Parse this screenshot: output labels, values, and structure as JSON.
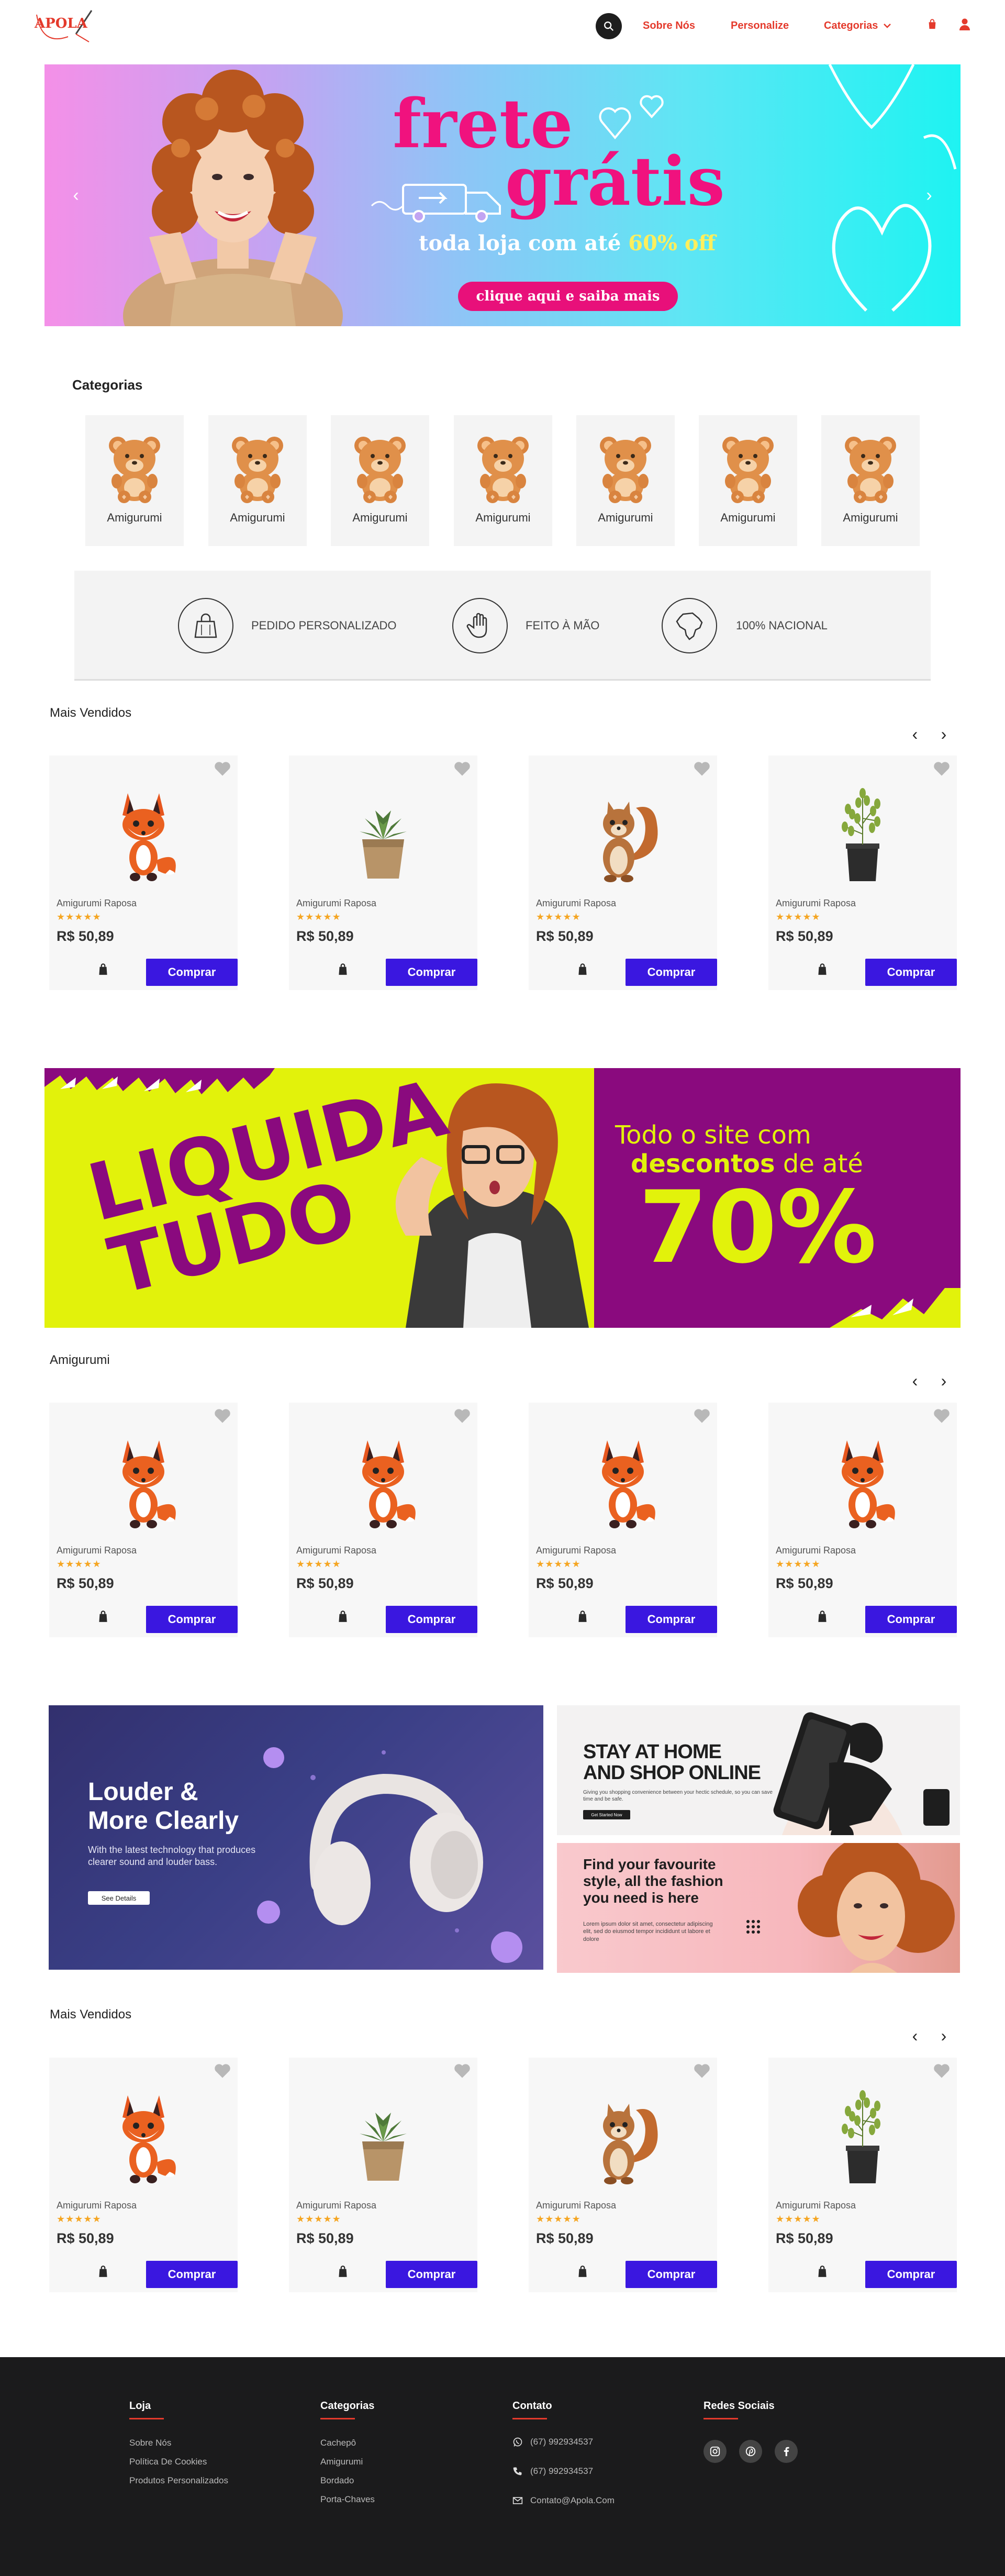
{
  "header": {
    "logo_text": "APOLA",
    "nav": {
      "about": "Sobre Nós",
      "personalize": "Personalize",
      "categories": "Categorias"
    }
  },
  "hero": {
    "title_line1": "frete",
    "title_line2": "grátis",
    "subtitle_prefix": "toda loja com até",
    "subtitle_highlight": "60% off",
    "cta": "clique aqui e saiba mais"
  },
  "categories": {
    "title": "Categorias",
    "items": [
      {
        "label": "Amigurumi"
      },
      {
        "label": "Amigurumi"
      },
      {
        "label": "Amigurumi"
      },
      {
        "label": "Amigurumi"
      },
      {
        "label": "Amigurumi"
      },
      {
        "label": "Amigurumi"
      },
      {
        "label": "Amigurumi"
      }
    ]
  },
  "features": [
    {
      "label": "PEDIDO PERSONALIZADO",
      "icon": "shopping-bag-icon"
    },
    {
      "label": "FEITO À MÃO",
      "icon": "hand-icon"
    },
    {
      "label": "100% NACIONAL",
      "icon": "brazil-map-icon"
    }
  ],
  "sections": {
    "best_sellers_1": {
      "title": "Mais Vendidos",
      "products": [
        {
          "name": "Amigurumi Raposa",
          "stars": "★★★★★",
          "price": "R$ 50,89",
          "buy": "Comprar",
          "image": "fox"
        },
        {
          "name": "Amigurumi Raposa",
          "stars": "★★★★★",
          "price": "R$ 50,89",
          "buy": "Comprar",
          "image": "succulent"
        },
        {
          "name": "Amigurumi Raposa",
          "stars": "★★★★★",
          "price": "R$ 50,89",
          "buy": "Comprar",
          "image": "squirrel"
        },
        {
          "name": "Amigurumi Raposa",
          "stars": "★★★★★",
          "price": "R$ 50,89",
          "buy": "Comprar",
          "image": "plant"
        }
      ]
    },
    "amigurumi": {
      "title": "Amigurumi",
      "products": [
        {
          "name": "Amigurumi Raposa",
          "stars": "★★★★★",
          "price": "R$ 50,89",
          "buy": "Comprar",
          "image": "fox"
        },
        {
          "name": "Amigurumi Raposa",
          "stars": "★★★★★",
          "price": "R$ 50,89",
          "buy": "Comprar",
          "image": "fox"
        },
        {
          "name": "Amigurumi Raposa",
          "stars": "★★★★★",
          "price": "R$ 50,89",
          "buy": "Comprar",
          "image": "fox"
        },
        {
          "name": "Amigurumi Raposa",
          "stars": "★★★★★",
          "price": "R$ 50,89",
          "buy": "Comprar",
          "image": "fox"
        }
      ]
    },
    "best_sellers_2": {
      "title": "Mais Vendidos",
      "products": [
        {
          "name": "Amigurumi Raposa",
          "stars": "★★★★★",
          "price": "R$ 50,89",
          "buy": "Comprar",
          "image": "fox"
        },
        {
          "name": "Amigurumi Raposa",
          "stars": "★★★★★",
          "price": "R$ 50,89",
          "buy": "Comprar",
          "image": "succulent"
        },
        {
          "name": "Amigurumi Raposa",
          "stars": "★★★★★",
          "price": "R$ 50,89",
          "buy": "Comprar",
          "image": "squirrel"
        },
        {
          "name": "Amigurumi Raposa",
          "stars": "★★★★★",
          "price": "R$ 50,89",
          "buy": "Comprar",
          "image": "plant"
        }
      ]
    }
  },
  "liquida": {
    "word1": "LIQUIDA",
    "word2": "TUDO",
    "line1": "Todo o site com",
    "line2_bold": "descontos",
    "line2_rest": "de até",
    "percent": "70%"
  },
  "promos": {
    "headphones": {
      "title1": "Louder &",
      "title2": "More Clearly",
      "body": "With the latest technology that produces clearer sound and louder bass.",
      "cta": "See Details"
    },
    "stay_home": {
      "title1": "STAY AT HOME",
      "title2": "AND SHOP ONLINE",
      "body": "Giving you shopping convenience between your hectic schedule, so you can save time and be safe.",
      "cta": "Get Started Now"
    },
    "fashion": {
      "title": "Find your favourite style, all the fashion you need is here",
      "body": "Lorem ipsum dolor sit amet, consectetur adipiscing elit, sed do eiusmod tempor incididunt ut labore et dolore"
    }
  },
  "footer": {
    "loja": {
      "title": "Loja",
      "items": [
        "Sobre Nós",
        "Política De Cookies",
        "Produtos Personalizados"
      ]
    },
    "categorias": {
      "title": "Categorias",
      "items": [
        "Cachepô",
        "Amigurumi",
        "Bordado",
        "Porta-Chaves"
      ]
    },
    "contato": {
      "title": "Contato",
      "whatsapp": "(67) 992934537",
      "phone": "(67) 992934537",
      "email": "Contato@Apola.Com"
    },
    "social": {
      "title": "Redes Sociais",
      "icons": [
        "instagram-icon",
        "pinterest-icon",
        "facebook-icon"
      ]
    }
  },
  "colors": {
    "accent": "#e43a2c",
    "buy_button": "#3a17e0",
    "hero_pink": "#f0127e",
    "liquida_yellow": "#e2f20b",
    "liquida_purple": "#8a0a7e"
  }
}
